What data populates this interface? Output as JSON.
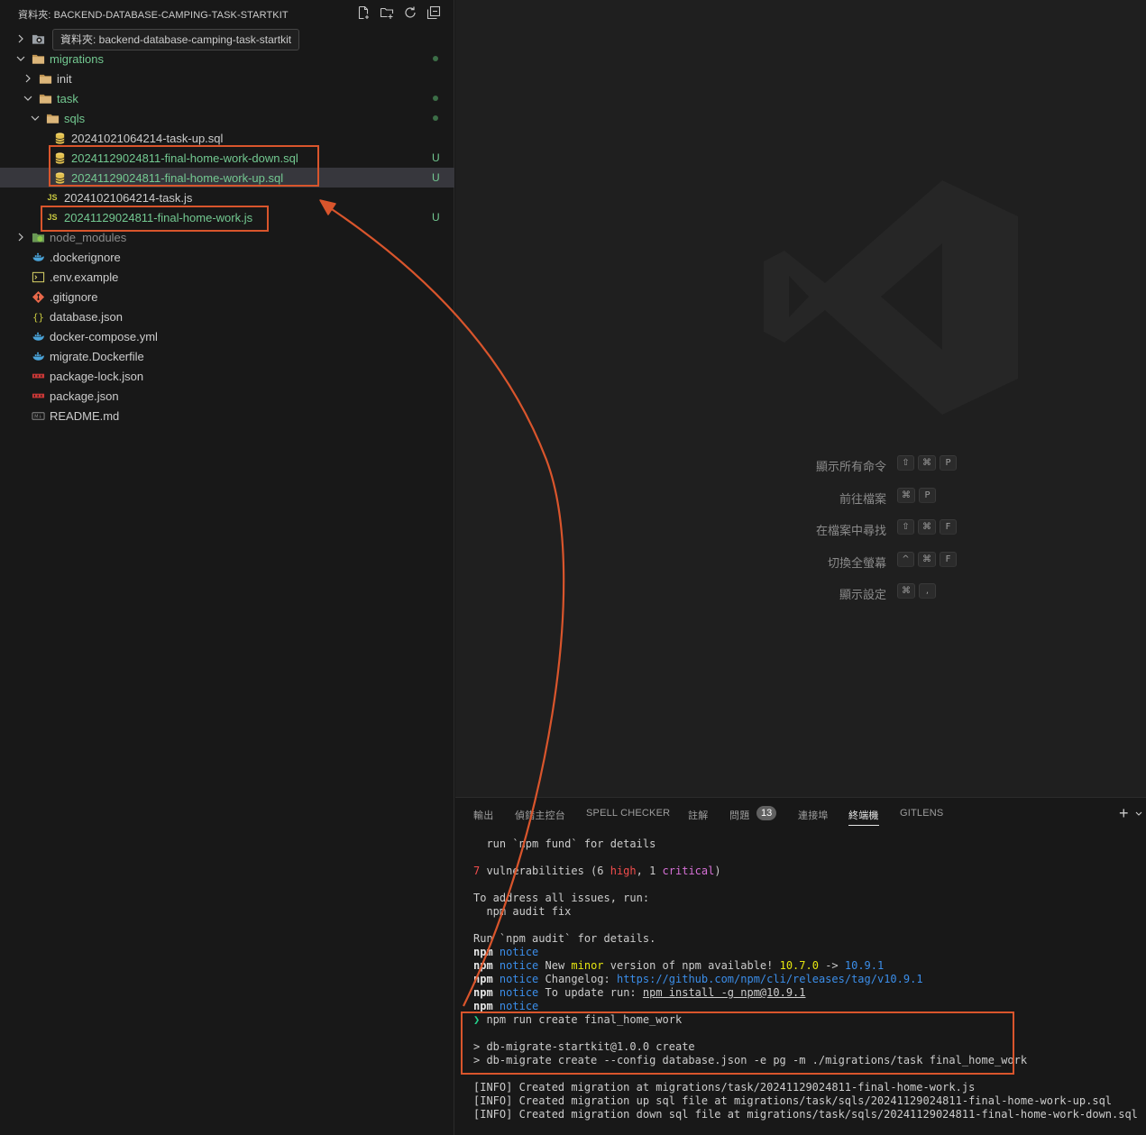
{
  "explorer": {
    "title": "資料夾: BACKEND-DATABASE-CAMPING-TASK-STARTKIT",
    "tooltip": "資料夾: backend-database-camping-task-startkit",
    "items": [
      {
        "label": "",
        "kind": "folder-special",
        "indent": 0,
        "expanded": false,
        "git": ""
      },
      {
        "label": "migrations",
        "kind": "folder",
        "indent": 0,
        "expanded": true,
        "git": "dot"
      },
      {
        "label": "init",
        "kind": "folder",
        "indent": 1,
        "expanded": false,
        "git": ""
      },
      {
        "label": "task",
        "kind": "folder",
        "indent": 1,
        "expanded": true,
        "git": "dot"
      },
      {
        "label": "sqls",
        "kind": "folder",
        "indent": 2,
        "expanded": true,
        "git": "dot"
      },
      {
        "label": "20241021064214-task-up.sql",
        "kind": "sql",
        "indent": 3,
        "git": ""
      },
      {
        "label": "20241129024811-final-home-work-down.sql",
        "kind": "sql",
        "indent": 3,
        "git": "U"
      },
      {
        "label": "20241129024811-final-home-work-up.sql",
        "kind": "sql",
        "indent": 3,
        "git": "U",
        "selected": true
      },
      {
        "label": "20241021064214-task.js",
        "kind": "js",
        "indent": 2,
        "git": ""
      },
      {
        "label": "20241129024811-final-home-work.js",
        "kind": "js",
        "indent": 2,
        "git": "U"
      },
      {
        "label": "node_modules",
        "kind": "folder-node",
        "indent": 0,
        "expanded": false,
        "git": ""
      },
      {
        "label": ".dockerignore",
        "kind": "docker",
        "indent": 0,
        "git": ""
      },
      {
        "label": ".env.example",
        "kind": "env",
        "indent": 0,
        "git": ""
      },
      {
        "label": ".gitignore",
        "kind": "git",
        "indent": 0,
        "git": ""
      },
      {
        "label": "database.json",
        "kind": "json",
        "indent": 0,
        "git": ""
      },
      {
        "label": "docker-compose.yml",
        "kind": "docker",
        "indent": 0,
        "git": ""
      },
      {
        "label": "migrate.Dockerfile",
        "kind": "docker",
        "indent": 0,
        "git": ""
      },
      {
        "label": "package-lock.json",
        "kind": "npm",
        "indent": 0,
        "git": ""
      },
      {
        "label": "package.json",
        "kind": "npm",
        "indent": 0,
        "git": ""
      },
      {
        "label": "README.md",
        "kind": "md",
        "indent": 0,
        "git": ""
      }
    ]
  },
  "editor": {
    "shortcuts": [
      {
        "label": "顯示所有命令",
        "keys": [
          "⇧",
          "⌘",
          "P"
        ]
      },
      {
        "label": "前往檔案",
        "keys": [
          "⌘",
          "P"
        ]
      },
      {
        "label": "在檔案中尋找",
        "keys": [
          "⇧",
          "⌘",
          "F"
        ]
      },
      {
        "label": "切換全螢幕",
        "keys": [
          "^",
          "⌘",
          "F"
        ]
      },
      {
        "label": "顯示設定",
        "keys": [
          "⌘",
          ","
        ]
      }
    ]
  },
  "panel": {
    "tabs": [
      {
        "label": "輸出",
        "active": false
      },
      {
        "label": "偵錯主控台",
        "active": false
      },
      {
        "label": "SPELL CHECKER",
        "active": false
      },
      {
        "label": "註解",
        "active": false
      },
      {
        "label": "問題",
        "active": false,
        "count": "13"
      },
      {
        "label": "連接埠",
        "active": false
      },
      {
        "label": "終端機",
        "active": true
      },
      {
        "label": "GITLENS",
        "active": false
      }
    ],
    "plus": "+",
    "terminal": [
      [
        {
          "t": "  run `npm fund` for details"
        }
      ],
      [
        {
          "t": ""
        }
      ],
      [
        {
          "t": "7",
          "c": "c-red"
        },
        {
          "t": " vulnerabilities (6 "
        },
        {
          "t": "high",
          "c": "c-red"
        },
        {
          "t": ", 1 "
        },
        {
          "t": "critical",
          "c": "c-magenta"
        },
        {
          "t": ")"
        }
      ],
      [
        {
          "t": ""
        }
      ],
      [
        {
          "t": "To address all issues, run:"
        }
      ],
      [
        {
          "t": "  npm audit fix"
        }
      ],
      [
        {
          "t": ""
        }
      ],
      [
        {
          "t": "Run `npm audit` for details."
        }
      ],
      [
        {
          "t": "npm",
          "c": "c-bold"
        },
        {
          "t": " "
        },
        {
          "t": "notice",
          "c": "c-blue"
        }
      ],
      [
        {
          "t": "npm",
          "c": "c-bold"
        },
        {
          "t": " "
        },
        {
          "t": "notice",
          "c": "c-blue"
        },
        {
          "t": " New "
        },
        {
          "t": "minor",
          "c": "c-yellow"
        },
        {
          "t": " version of npm available! "
        },
        {
          "t": "10.7.0",
          "c": "c-yellow"
        },
        {
          "t": " -> "
        },
        {
          "t": "10.9.1",
          "c": "c-blue"
        }
      ],
      [
        {
          "t": "npm",
          "c": "c-bold"
        },
        {
          "t": " "
        },
        {
          "t": "notice",
          "c": "c-blue"
        },
        {
          "t": " Changelog: "
        },
        {
          "t": "https://github.com/npm/cli/releases/tag/v10.9.1",
          "c": "c-blue"
        }
      ],
      [
        {
          "t": "npm",
          "c": "c-bold"
        },
        {
          "t": " "
        },
        {
          "t": "notice",
          "c": "c-blue"
        },
        {
          "t": " To update run: "
        },
        {
          "t": "npm install -g npm@10.9.1",
          "c": "u"
        }
      ],
      [
        {
          "t": "npm",
          "c": "c-bold"
        },
        {
          "t": " "
        },
        {
          "t": "notice",
          "c": "c-blue"
        }
      ],
      [
        {
          "t": "❯",
          "c": "c-green"
        },
        {
          "t": " npm run create final_home_work"
        }
      ],
      [
        {
          "t": ""
        }
      ],
      [
        {
          "t": "> db-migrate-startkit@1.0.0 create"
        }
      ],
      [
        {
          "t": "> db-migrate create --config database.json -e pg -m ./migrations/task final_home_work"
        }
      ],
      [
        {
          "t": ""
        }
      ],
      [
        {
          "t": "[INFO] Created migration at migrations/task/20241129024811-final-home-work.js"
        }
      ],
      [
        {
          "t": "[INFO] Created migration up sql file at migrations/task/sqls/20241129024811-final-home-work-up.sql"
        }
      ],
      [
        {
          "t": "[INFO] Created migration down sql file at migrations/task/sqls/20241129024811-final-home-work-down.sql"
        }
      ]
    ]
  },
  "colors": {
    "annotation": "#d9552c",
    "git_untracked": "#73c991",
    "background": "#1f1f1f"
  },
  "icons": {
    "new-file": "new-file-icon",
    "new-folder": "new-folder-icon",
    "refresh": "refresh-icon",
    "collapse": "collapse-all-icon"
  }
}
